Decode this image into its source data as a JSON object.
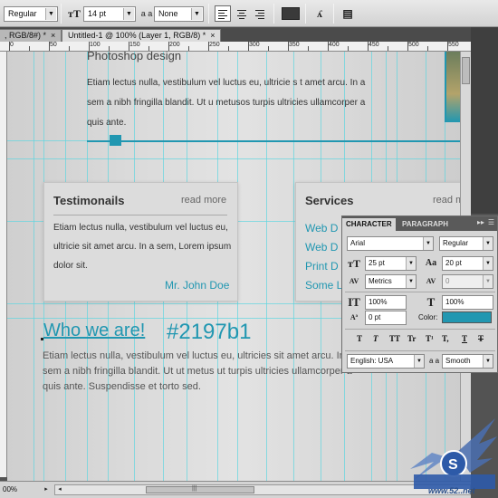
{
  "options_bar": {
    "font_style": "Regular",
    "font_size": "14 pt",
    "antialias_label": "a a",
    "antialias": "None",
    "text_color": "#3a3a3a"
  },
  "doc_tabs": [
    {
      "label": ", RGB/8#) *",
      "close": "×"
    },
    {
      "label": "Untitled-1 @ 100% (Layer 1, RGB/8) *",
      "close": "×"
    }
  ],
  "ruler": {
    "ticks": [
      "0",
      "50",
      "100",
      "150",
      "200",
      "250",
      "300",
      "350",
      "400",
      "450",
      "500",
      "550"
    ]
  },
  "canvas": {
    "psd_title": "Photoshop design",
    "body_text": "Etiam lectus nulla, vestibulum vel luctus eu, ultricie s t amet arcu. In a sem a nibh fringilla blandit. Ut u metusos turpis ultricies ullamcorper a quis ante.",
    "testimonials": {
      "title": "Testimonails",
      "more": "read more",
      "text": "Etiam lectus nulla, vestibulum vel luctus eu, ultricie sit amet arcu. In a sem, Lorem ipsum dolor sit.",
      "author": "Mr. John Doe"
    },
    "services": {
      "title": "Services",
      "more": "read m",
      "links": [
        "Web D",
        "Web D",
        "Print D",
        "Some L"
      ]
    },
    "who_title": "Who we are!",
    "hex_value": "#2197b1",
    "who_text": "Etiam lectus nulla, vestibulum vel luctus eu, ultricies sit amet arcu. In a sem a nibh fringilla blandit. Ut ut metus ut turpis ultricies ullamcorper a quis ante. Suspendisse et torto sed.",
    "accent": "#2197b1"
  },
  "character_panel": {
    "tabs": [
      "CHARACTER",
      "PARAGRAPH"
    ],
    "menu": "▸▸",
    "font_family": "Arial",
    "font_style": "Regular",
    "size": "25 pt",
    "leading": "20 pt",
    "kerning": "Metrics",
    "tracking": "0",
    "vertical_scale": "100%",
    "horizontal_scale": "100%",
    "baseline_shift": "0 pt",
    "color_label": "Color:",
    "color": "#2197b1",
    "style_buttons": [
      "T",
      "T",
      "TT",
      "Tr",
      "T¹",
      "T,",
      "T",
      "T"
    ],
    "language": "English: USA",
    "antialias_label": "a a",
    "antialias": "Smooth"
  },
  "status": {
    "zoom": "00%"
  },
  "watermark": {
    "text": "www.52..net"
  }
}
